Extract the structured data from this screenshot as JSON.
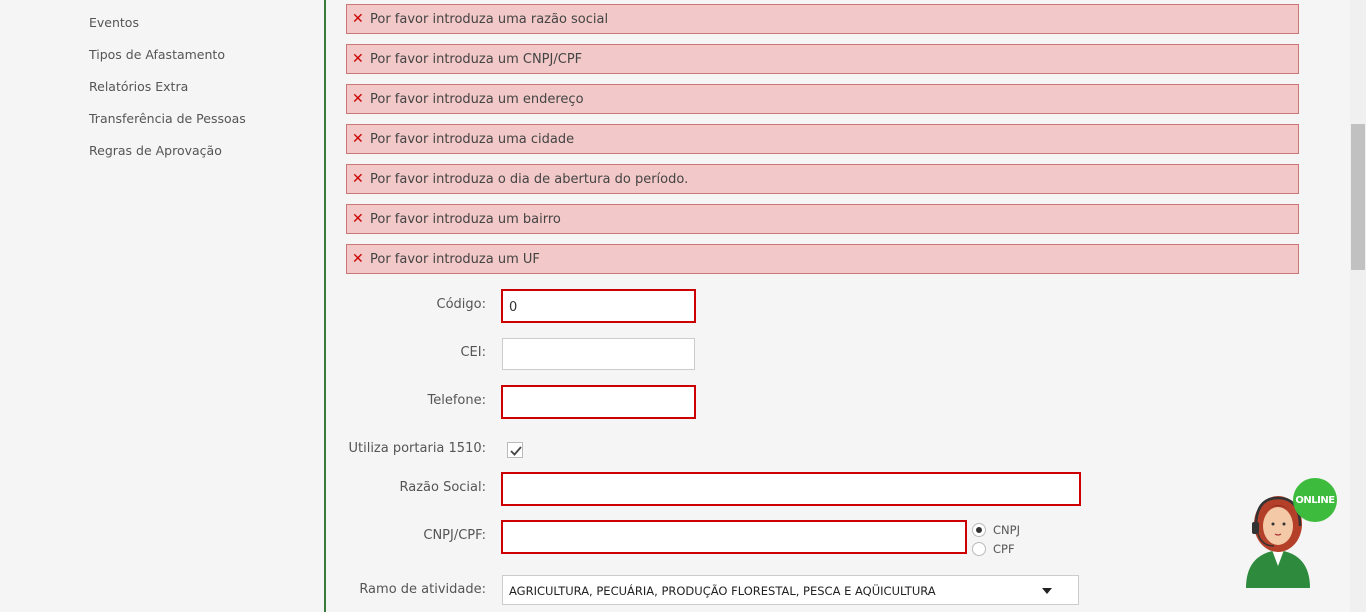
{
  "sidebar": {
    "items": [
      {
        "label": "Eventos"
      },
      {
        "label": "Tipos de Afastamento"
      },
      {
        "label": "Relatórios Extra"
      },
      {
        "label": "Transferência de Pessoas"
      },
      {
        "label": "Regras de Aprovação"
      }
    ]
  },
  "errors": [
    "Por favor introduza uma razão social",
    "Por favor introduza um CNPJ/CPF",
    "Por favor introduza um endereço",
    "Por favor introduza uma cidade",
    "Por favor introduza o dia de abertura do período.",
    "Por favor introduza um bairro",
    "Por favor introduza um UF"
  ],
  "form": {
    "codigo_label": "Código:",
    "codigo_value": "0",
    "cei_label": "CEI:",
    "telefone_label": "Telefone:",
    "portaria_label": "Utiliza portaria 1510:",
    "portaria_checked": true,
    "razao_label": "Razão Social:",
    "cnpj_label": "CNPJ/CPF:",
    "doc_type_options": [
      "CNPJ",
      "CPF"
    ],
    "doc_type_selected": "CNPJ",
    "ramo_label": "Ramo de atividade:",
    "ramo_value": "AGRICULTURA, PECUÁRIA, PRODUÇÃO FLORESTAL, PESCA E AQÜICULTURA"
  },
  "support_widget": {
    "status": "ONLINE",
    "status_color": "#3dbb3d"
  },
  "colors": {
    "error_bg": "#f2c8c8",
    "error_icon": "#cc0000",
    "invalid_border": "#cc0000",
    "divider": "#3a7a3a"
  }
}
